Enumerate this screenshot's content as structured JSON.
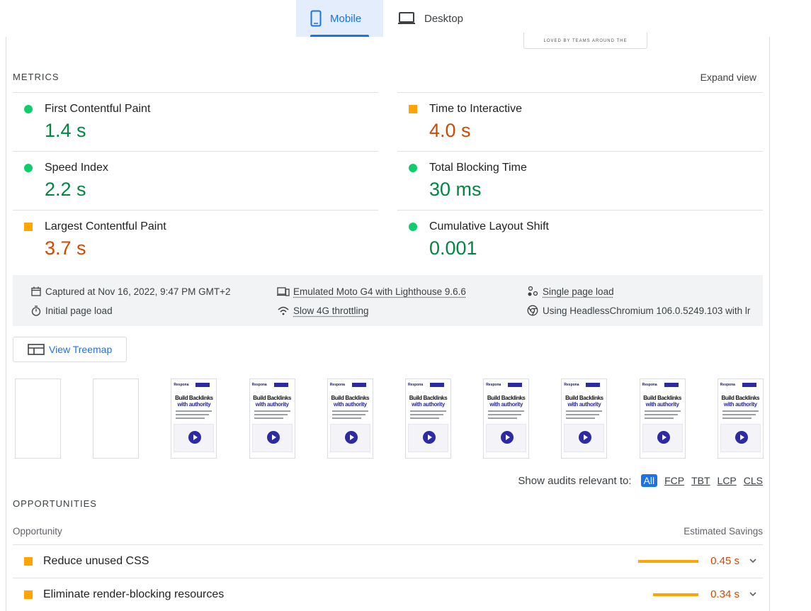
{
  "tabs": [
    {
      "label": "Mobile",
      "icon": "smartphone-icon",
      "active": true
    },
    {
      "label": "Desktop",
      "icon": "laptop-icon",
      "active": false
    }
  ],
  "screenshot_caption": "LOVED BY TEAMS AROUND THE",
  "metrics_section": {
    "title": "METRICS",
    "expand_label": "Expand view",
    "items": [
      {
        "label": "First Contentful Paint",
        "value": "1.4 s",
        "status": "pass"
      },
      {
        "label": "Time to Interactive",
        "value": "4.0 s",
        "status": "average"
      },
      {
        "label": "Speed Index",
        "value": "2.2 s",
        "status": "pass"
      },
      {
        "label": "Total Blocking Time",
        "value": "30 ms",
        "status": "pass"
      },
      {
        "label": "Largest Contentful Paint",
        "value": "3.7 s",
        "status": "average"
      },
      {
        "label": "Cumulative Layout Shift",
        "value": "0.001",
        "status": "pass"
      }
    ],
    "colors": {
      "pass": "#0cce6b",
      "average": "#ffa400",
      "pass_text": "#018642",
      "average_text": "#d04900"
    }
  },
  "runtime_info": {
    "captured": "Captured at Nov 16, 2022, 9:47 PM GMT+2",
    "page_load": "Initial page load",
    "device": "Emulated Moto G4 with Lighthouse 9.6.6",
    "throttling": "Slow 4G throttling",
    "load_type": "Single page load",
    "browser": "Using HeadlessChromium 106.0.5249.103 with lr"
  },
  "treemap_button": "View Treemap",
  "filmstrip": {
    "frames": [
      {
        "blank": true
      },
      {
        "blank": true
      },
      {
        "blank": false
      },
      {
        "blank": false
      },
      {
        "blank": false
      },
      {
        "blank": false
      },
      {
        "blank": false
      },
      {
        "blank": false
      },
      {
        "blank": false
      },
      {
        "blank": false
      }
    ],
    "frame_logo": "Respona",
    "frame_title_line1": "Build Backlinks",
    "frame_title_line2": "with authority"
  },
  "audit_filter": {
    "label": "Show audits relevant to:",
    "options": [
      "All",
      "FCP",
      "TBT",
      "LCP",
      "CLS"
    ],
    "selected": "All"
  },
  "opportunities": {
    "title": "OPPORTUNITIES",
    "col_opportunity": "Opportunity",
    "col_savings": "Estimated Savings",
    "items": [
      {
        "label": "Reduce unused CSS",
        "savings": "0.45 s",
        "savings_seconds": 0.45
      },
      {
        "label": "Eliminate render-blocking resources",
        "savings": "0.34 s",
        "savings_seconds": 0.34
      }
    ]
  }
}
